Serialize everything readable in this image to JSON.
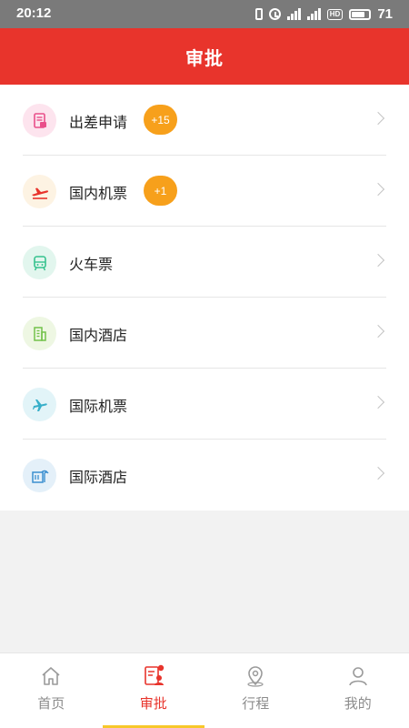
{
  "status_bar": {
    "time": "20:12",
    "battery": "71"
  },
  "header": {
    "title": "审批"
  },
  "items": [
    {
      "label": "出差申请",
      "badge": "+15",
      "icon": "document-icon",
      "icon_bg": "#fde4ee",
      "icon_color": "#e94f8a"
    },
    {
      "label": "国内机票",
      "badge": "+1",
      "icon": "plane-takeoff-icon",
      "icon_bg": "#fdf3e3",
      "icon_color": "#e8342c"
    },
    {
      "label": "火车票",
      "badge": "",
      "icon": "train-icon",
      "icon_bg": "#e2f6ee",
      "icon_color": "#35c28e"
    },
    {
      "label": "国内酒店",
      "badge": "",
      "icon": "building-icon",
      "icon_bg": "#eef7e3",
      "icon_color": "#72c24a"
    },
    {
      "label": "国际机票",
      "badge": "",
      "icon": "plane-icon",
      "icon_bg": "#e2f4f8",
      "icon_color": "#37afc9"
    },
    {
      "label": "国际酒店",
      "badge": "",
      "icon": "hotel-icon",
      "icon_bg": "#e4f0f9",
      "icon_color": "#3b8fd0"
    }
  ],
  "tabs": [
    {
      "label": "首页",
      "icon": "home-icon",
      "active": false
    },
    {
      "label": "审批",
      "icon": "approval-icon",
      "active": true
    },
    {
      "label": "行程",
      "icon": "location-icon",
      "active": false
    },
    {
      "label": "我的",
      "icon": "user-icon",
      "active": false
    }
  ],
  "colors": {
    "accent": "#e8342c",
    "badge": "#f7a01b",
    "tab_indicator": "#f7c82a"
  }
}
